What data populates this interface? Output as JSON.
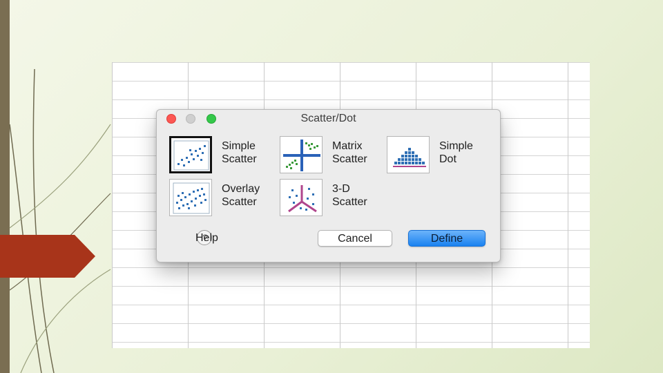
{
  "dialog": {
    "title": "Scatter/Dot",
    "options": [
      {
        "id": "simple-scatter",
        "line1": "Simple",
        "line2": "Scatter",
        "selected": true
      },
      {
        "id": "matrix-scatter",
        "line1": "Matrix",
        "line2": "Scatter",
        "selected": false
      },
      {
        "id": "simple-dot",
        "line1": "Simple",
        "line2": "Dot",
        "selected": false
      },
      {
        "id": "overlay-scatter",
        "line1": "Overlay",
        "line2": "Scatter",
        "selected": false
      },
      {
        "id": "3d-scatter",
        "line1": "3-D",
        "line2": "Scatter",
        "selected": false
      }
    ],
    "buttons": {
      "help": "Help",
      "help_glyph": "?",
      "cancel": "Cancel",
      "define": "Define"
    }
  },
  "colors": {
    "accent_button": "#1a82f0",
    "close": "#fc5753",
    "maximize": "#34c84a",
    "decorative_tab": "#a8341a",
    "left_strip": "#7a6e52"
  }
}
